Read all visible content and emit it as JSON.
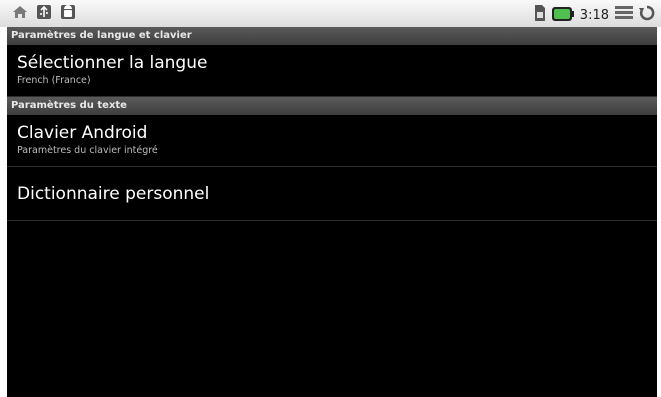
{
  "status_bar": {
    "time": "3:18",
    "left_icons": [
      "home-icon",
      "usb-icon",
      "android-icon"
    ],
    "right_icons": [
      "sim-icon",
      "battery-icon",
      "list-icon",
      "sync-icon"
    ]
  },
  "sections": [
    {
      "header": "Paramètres de langue et clavier",
      "items": [
        {
          "title": "Sélectionner la langue",
          "summary": "French (France)"
        }
      ]
    },
    {
      "header": "Paramètres du texte",
      "items": [
        {
          "title": "Clavier Android",
          "summary": "Paramètres du clavier intégré"
        },
        {
          "title": "Dictionnaire personnel"
        }
      ]
    }
  ],
  "colors": {
    "background": "#000000",
    "status_bar": "#e8e8e8",
    "category_bar": "#4a4a4a",
    "battery": "#4fc04f"
  }
}
